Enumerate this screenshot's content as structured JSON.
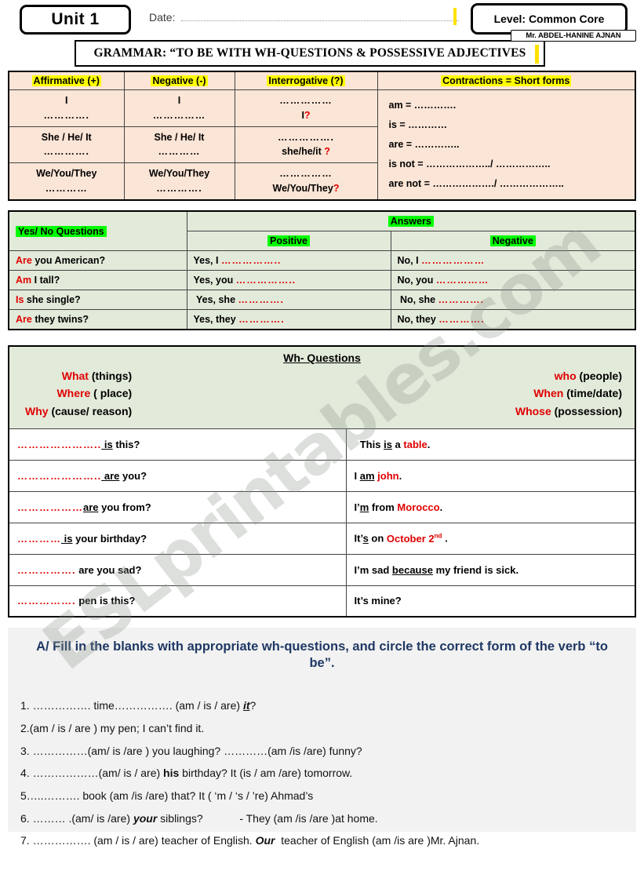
{
  "header": {
    "unit": "Unit 1",
    "date_label": "Date:",
    "date_value": "",
    "level": "Level: Common Core",
    "teacher": "Mr. ABDEL-HANINE AJNAN",
    "grammar_title": "GRAMMAR: “TO BE WITH WH-QUESTIONS  &  POSSESSIVE  ADJECTIVES",
    "cursor_color": "#ffe100"
  },
  "forms_table": {
    "headers": [
      "Affirmative (+)",
      "Negative (-)",
      "Interrogative (?)",
      "Contractions = Short forms"
    ],
    "rows": [
      {
        "affirmative_subject": "I",
        "affirmative_dots": "………….",
        "negative_subject": "I",
        "negative_dots": "……………",
        "interrogative_dots": "……………",
        "interrogative_subject": "I",
        "interrogative_mark": "?"
      },
      {
        "affirmative_subject": "She / He/ It",
        "affirmative_dots": "………….",
        "negative_subject": "She / He/ It",
        "negative_dots": "…………",
        "interrogative_dots": "…………….",
        "interrogative_subject": "she/he/it",
        "interrogative_mark": "?"
      },
      {
        "affirmative_subject": "We/You/They",
        "affirmative_dots": "…………",
        "negative_subject": "We/You/They",
        "negative_dots": "………….",
        "interrogative_dots": "……………",
        "interrogative_subject": "We/You/They",
        "interrogative_mark": "?"
      }
    ],
    "contractions": [
      "am = ………….",
      "is = …………",
      "are = …………..",
      "is not = ………………../ ……………..",
      "are not = ………………./ ……………….."
    ]
  },
  "yesno_table": {
    "col_questions": "Yes/ No Questions",
    "col_answers": "Answers",
    "col_positive": "Positive",
    "col_negative": "Negative",
    "rows": [
      {
        "q_aux": "Are",
        "q_rest": " you American?",
        "pos": "Yes, I ",
        "pos_dots": "……………..",
        "neg": "No, I ",
        "neg_dots": "………………"
      },
      {
        "q_aux": "Am",
        "q_rest": " I tall?",
        "pos": "Yes, you ",
        "pos_dots": "……………..",
        "neg": "No, you ",
        "neg_dots": "……………"
      },
      {
        "q_aux": "Is",
        "q_rest": " she single?",
        "pos": "Yes, she ",
        "pos_dots": "………….",
        "neg": "No, she ",
        "neg_dots": "…………."
      },
      {
        "q_aux": "Are",
        "q_rest": " they twins?",
        "pos": "Yes, they ",
        "pos_dots": "………….",
        "neg": "No, they ",
        "neg_dots": "…………."
      }
    ]
  },
  "wh_table": {
    "title": "Wh- Questions",
    "left_items": [
      {
        "word": "What",
        "gloss": " (things)"
      },
      {
        "word": "Where",
        "gloss": " ( place)"
      },
      {
        "word": "Why",
        "gloss": "  (cause/ reason)"
      }
    ],
    "right_items": [
      {
        "word": "who",
        "gloss": " (people)"
      },
      {
        "word": "When",
        "gloss": " (time/date)"
      },
      {
        "word": "Whose",
        "gloss": " (possession)"
      }
    ],
    "rows": [
      {
        "q_dots": "…………………..",
        "q_underline": " is",
        "q_rest": " this?",
        "a_pre": "This ",
        "a_underline": "is",
        "a_mid": " a ",
        "a_red": "table",
        "a_post": "."
      },
      {
        "q_dots": "…………………..",
        "q_underline": " are",
        "q_rest": " you?",
        "a_pre": "I ",
        "a_underline": "am",
        "a_mid": " ",
        "a_red": "john",
        "a_post": "."
      },
      {
        "q_dots": "………………",
        "q_underline": "are",
        "q_rest": " you from?",
        "a_pre": "I’",
        "a_underline": "m",
        "a_mid": " from ",
        "a_red": "Morocco",
        "a_post": "."
      },
      {
        "q_dots": "…………",
        "q_underline": " is",
        "q_rest": " your birthday?",
        "a_pre": "It’",
        "a_underline": "s",
        "a_mid": " on ",
        "a_red": "October 2",
        "a_red_sup": "nd",
        "a_post": " ."
      },
      {
        "q_dots": "…………….",
        "q_underline": "",
        "q_rest": " are you sad?",
        "a_pre": "I’m sad ",
        "a_underline": "because",
        "a_mid": " my friend is sick.",
        "a_red": "",
        "a_post": ""
      },
      {
        "q_dots": "…………….",
        "q_underline": "",
        "q_rest": " pen is this?",
        "a_pre": "It’s  mine?",
        "a_underline": "",
        "a_mid": "",
        "a_red": "",
        "a_post": ""
      }
    ]
  },
  "exercise": {
    "title": "A/ Fill in the blanks with appropriate wh-questions, and circle the correct form of the verb “to be”.",
    "title_color": "#1f3864",
    "items": [
      {
        "num": "1. ",
        "parts": [
          {
            "t": "……………. time……………. (am / is / are) ",
            "s": "n"
          },
          {
            "t": "it",
            "s": "biu"
          },
          {
            "t": "?",
            "s": "n"
          }
        ]
      },
      {
        "num": "2.",
        "parts": [
          {
            "t": "(am / is / are ) my pen; I can’t find it.",
            "s": "n"
          }
        ]
      },
      {
        "num": "3. ",
        "parts": [
          {
            "t": "……………(am/ is /are ) you laughing? …………(am /is /are) funny?",
            "s": "n"
          }
        ]
      },
      {
        "num": "4. ",
        "parts": [
          {
            "t": "………………(am/ is / are) ",
            "s": "n"
          },
          {
            "t": "his",
            "s": "b"
          },
          {
            "t": " birthday? It (is / am /are) tomorrow.",
            "s": "n"
          }
        ]
      },
      {
        "num": "5",
        "parts": [
          {
            "t": "…..………. book (am /is /are) that? It ( ‘m / ‘s / ’re) Ahmad’s",
            "s": "n"
          }
        ]
      },
      {
        "num": "6. ",
        "parts": [
          {
            "t": "……… .(am/ is /are) ",
            "s": "n"
          },
          {
            "t": "your",
            "s": "bi"
          },
          {
            "t": " siblings?            - They (am /is /are )at home.",
            "s": "n"
          }
        ]
      },
      {
        "num": "7. ",
        "parts": [
          {
            "t": "……………. (am / is / are) teacher of English. ",
            "s": "n"
          },
          {
            "t": "Our",
            "s": "bi"
          },
          {
            "t": "  teacher of English (am /is are )Mr. Ajnan.",
            "s": "n"
          }
        ]
      }
    ]
  },
  "watermark": {
    "text": "ESLprintables.com"
  }
}
